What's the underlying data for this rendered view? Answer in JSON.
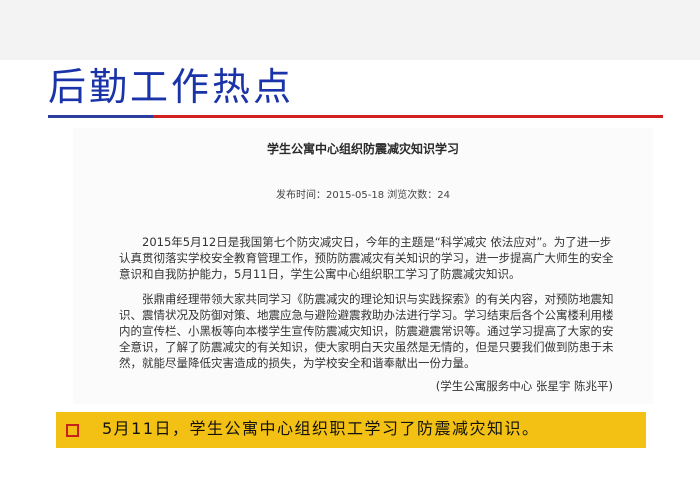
{
  "slide": {
    "title": "后勤工作热点"
  },
  "article": {
    "title": "学生公寓中心组织防震减灾知识学习",
    "meta": "发布时间：2015-05-18 浏览次数：24",
    "paragraph1": "2015年5月12日是我国第七个防灾减灾日，今年的主题是“科学减灾 依法应对”。为了进一步认真贯彻落实学校安全教育管理工作，预防防震减灾有关知识的学习，进一步提高广大师生的安全意识和自我防护能力，5月11日，学生公寓中心组织职工学习了防震减灾知识。",
    "paragraph2": "张鼎甫经理带领大家共同学习《防震减灾的理论知识与实践探索》的有关内容，对预防地震知识、震情状况及防御对策、地震应急与避险避震救助办法进行学习。学习结束后各个公寓楼利用楼内的宣传栏、小黑板等向本楼学生宣传防震减灾知识，防震避震常识等。通过学习提高了大家的安全意识，了解了防震减灾的有关知识，使大家明白天灾虽然是无情的，但是只要我们做到防患于未然，就能尽量降低灾害造成的损失，为学校安全和谐奉献出一份力量。",
    "signature": "(学生公寓服务中心 张星宇 陈兆平)"
  },
  "highlight": {
    "icon": "square-bullet-icon",
    "text": "5月11日，学生公寓中心组织职工学习了防震减灾知识。"
  },
  "colors": {
    "title": "#1a33a8",
    "rule_blue": "#2b3d9e",
    "rule_red": "#d21f1f",
    "highlight_bg": "#f3c113",
    "bullet": "#c8201a"
  }
}
